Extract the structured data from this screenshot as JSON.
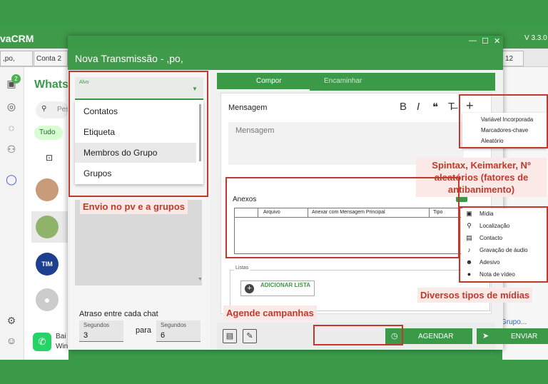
{
  "app": {
    "title": "vaCRM",
    "version": "V 3.3.0",
    "tabs": [
      ",po,",
      "Conta 2",
      "12"
    ],
    "whatsapp_header": "WhatsA",
    "search_placeholder": "Pes",
    "filter_all": "Tudo",
    "badge_count": "2",
    "chat_tim": "TIM",
    "right_link": "Grupo...",
    "bottom_whatsapp": "Bai",
    "bottom_windows": "Windows"
  },
  "modal": {
    "title": "Nova Transmissão - ,po,",
    "target": {
      "label": "Alvo",
      "options": [
        "Contatos",
        "Etiqueta",
        "Membros do Grupo",
        "Grupos"
      ],
      "highlighted": "Membros do Grupo"
    },
    "delay": {
      "label": "Atraso entre cada chat",
      "from_label": "Segundos",
      "from_value": "3",
      "between": "para",
      "to_label": "Segundos",
      "to_value": "6"
    },
    "tabs": [
      "Compor",
      "Encaminhar"
    ],
    "message": {
      "label": "Mensagem",
      "placeholder": "Mensagem",
      "toolbar": [
        "B",
        "I",
        "❝",
        "T̶",
        "+"
      ]
    },
    "attachments": {
      "label": "Anexos",
      "columns": [
        "Arquivo",
        "Anexar com Mensagem Principal",
        "Tipo"
      ]
    },
    "lists": {
      "label": "Listas",
      "add_button": "ADICIONAR LISTA"
    },
    "footer": {
      "schedule_button": "AGENDAR",
      "send_button": "ENVIAR"
    }
  },
  "variables_menu": {
    "items": [
      "Variável Incorporada",
      "Marcadores-chave",
      "Aleatório"
    ]
  },
  "media_menu": {
    "items": [
      {
        "label": "Mídia",
        "icon": "image-icon"
      },
      {
        "label": "Localização",
        "icon": "location-icon"
      },
      {
        "label": "Contacto",
        "icon": "contact-card-icon"
      },
      {
        "label": "Gravação de áudio",
        "icon": "microphone-icon"
      },
      {
        "label": "Adesivo",
        "icon": "sticker-icon"
      },
      {
        "label": "Nota de vídeo",
        "icon": "video-note-icon"
      }
    ]
  },
  "annotations": {
    "groups_callout": "Envio no pv e a grupos",
    "schedule_callout": "Agende campanhas",
    "antiban_callout": "Spintax, Keimarker, Nº aleatórios (fatores de antibanimento)",
    "media_callout": "Diversos tipos de mídias"
  },
  "colors": {
    "brand_green": "#3b9a47",
    "annotation_red": "#c0392b",
    "annotation_bg": "#fbe9e7"
  }
}
